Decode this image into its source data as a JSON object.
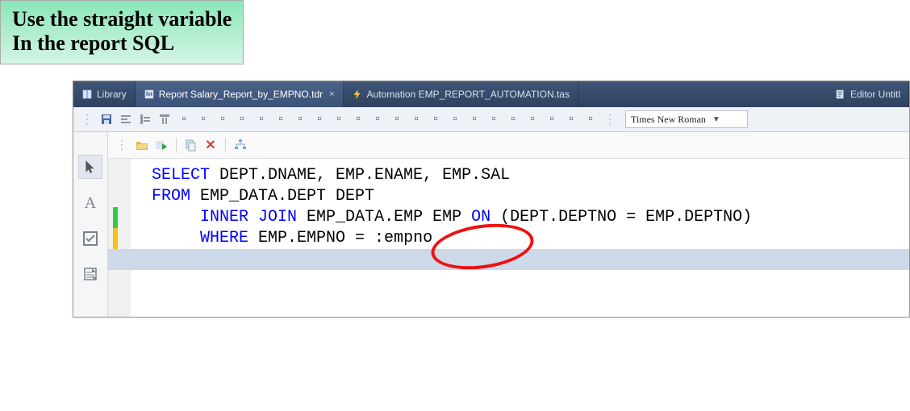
{
  "callout": {
    "line1": "Use the straight variable",
    "line2": "In the report SQL"
  },
  "tabs": {
    "library": "Library",
    "report": "Report Salary_Report_by_EMPNO.tdr",
    "automation": "Automation EMP_REPORT_AUTOMATION.tas",
    "editor": "Editor Untitl"
  },
  "toolbar": {
    "font_name": "Times New Roman"
  },
  "sql": {
    "l1_kw": "SELECT",
    "l1_rest": " DEPT.DNAME, EMP.ENAME, EMP.SAL",
    "l2_kw": "FROM",
    "l2_rest": " EMP_DATA.DEPT DEPT",
    "l3_kw1": "INNER",
    "l3_kw2": " JOIN",
    "l3_mid": " EMP_DATA.EMP EMP ",
    "l3_kw3": "ON",
    "l3_rest": " (DEPT.DEPTNO = EMP.DEPTNO)",
    "l4_kw": "WHERE",
    "l4_rest": " EMP.EMPNO = :empno"
  }
}
